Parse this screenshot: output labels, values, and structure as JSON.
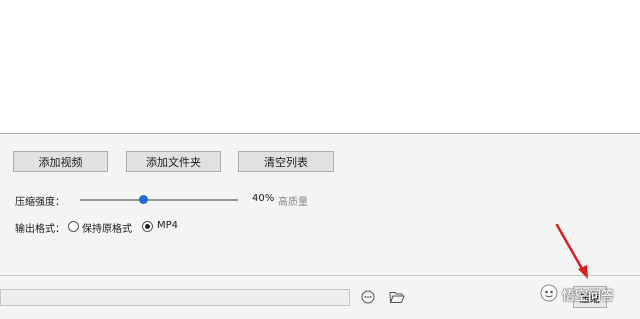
{
  "file_list": {
    "items": []
  },
  "toolbar": {
    "add_video_label": "添加视频",
    "add_folder_label": "添加文件夹",
    "clear_list_label": "清空列表"
  },
  "compression": {
    "label": "压缩强度：",
    "percent_text": "40%",
    "level_fraction": 0.4,
    "quality_text": "高质量"
  },
  "output_format": {
    "label": "输出格式：",
    "options": [
      {
        "label": "保持原格式",
        "selected": false
      },
      {
        "label": "MP4",
        "selected": true
      }
    ]
  },
  "bottom_bar": {
    "path_value": "",
    "start_label": "压缩"
  },
  "watermark": {
    "text": "悟空问答"
  },
  "colors": {
    "accent": "#1f6fd1",
    "annotation_arrow": "#d9201f"
  },
  "icons": {
    "more": "more-dots-icon",
    "folder": "folder-open-icon"
  }
}
